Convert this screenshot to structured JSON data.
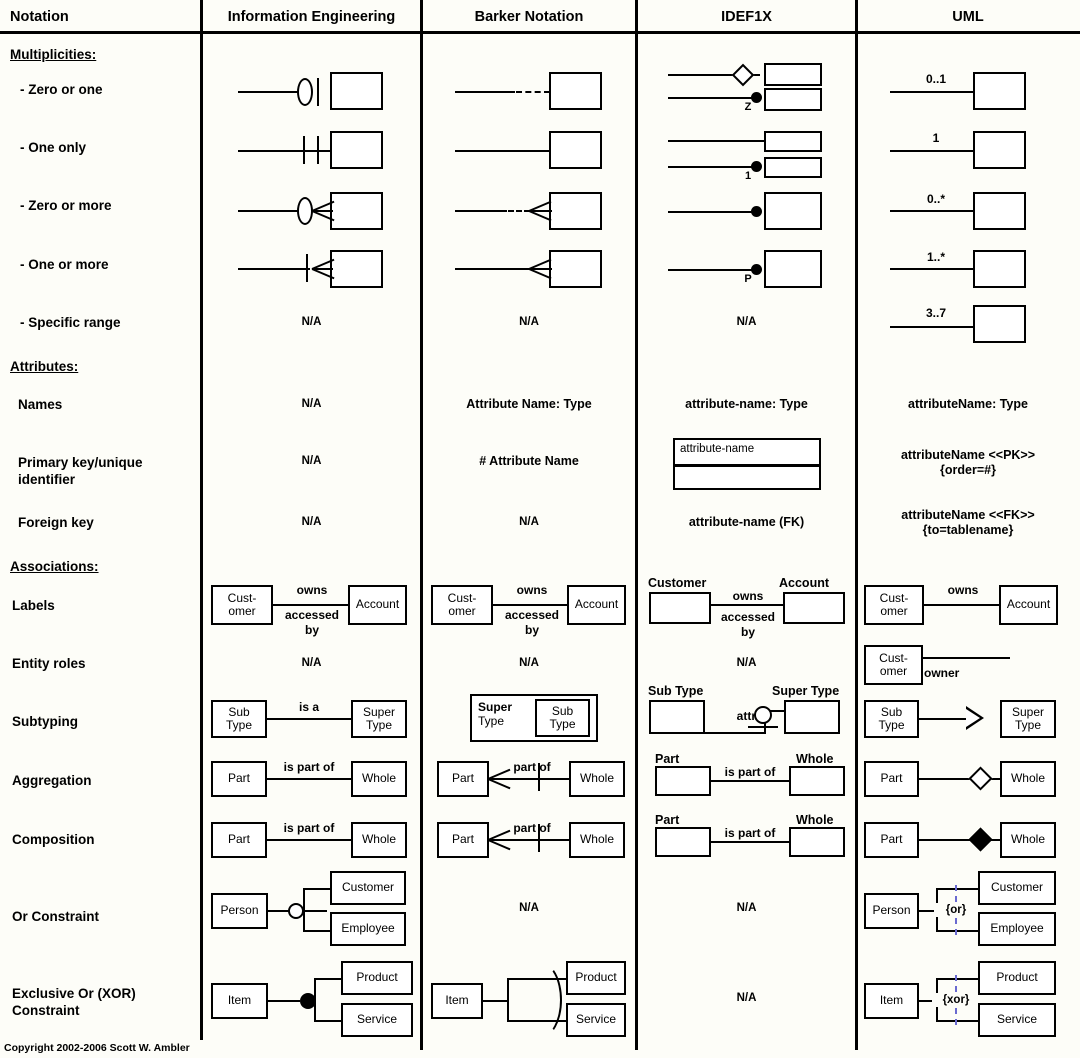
{
  "columns": [
    {
      "id": "notation",
      "label": "Notation"
    },
    {
      "id": "ie",
      "label": "Information Engineering"
    },
    {
      "id": "barker",
      "label": "Barker Notation"
    },
    {
      "id": "idef1x",
      "label": "IDEF1X"
    },
    {
      "id": "uml",
      "label": "UML"
    }
  ],
  "sections": {
    "multiplicities": "Multiplicities:",
    "attributes": "Attributes:",
    "associations": "Associations:"
  },
  "rows": {
    "zero_or_one": "- Zero or one",
    "one_only": "- One only",
    "zero_or_more": "- Zero or more",
    "one_or_more": "- One or more",
    "specific_range": "- Specific range",
    "names": "Names",
    "primary_key": "Primary key/unique identifier",
    "primary_key_l1": "Primary key/unique",
    "primary_key_l2": "identifier",
    "foreign_key": "Foreign key",
    "labels": "Labels",
    "entity_roles": "Entity roles",
    "subtyping": "Subtyping",
    "aggregation": "Aggregation",
    "composition": "Composition",
    "or_constraint": "Or Constraint",
    "xor_constraint": "Exclusive Or (XOR) Constraint",
    "xor_constraint_l1": "Exclusive Or (XOR)",
    "xor_constraint_l2": "Constraint"
  },
  "na": "N/A",
  "multiplicity_annotations": {
    "idef1x_zero_or_one": "Z",
    "idef1x_one_only": "1",
    "idef1x_one_or_more": "P",
    "uml_zero_or_one": "0..1",
    "uml_one_only": "1",
    "uml_zero_or_more": "0..*",
    "uml_one_or_more": "1..*",
    "uml_specific_range": "3..7"
  },
  "attributes": {
    "names": {
      "ie": "N/A",
      "barker": "Attribute Name: Type",
      "idef1x": "attribute-name: Type",
      "uml": "attributeName: Type"
    },
    "primary_key": {
      "ie": "N/A",
      "barker": "# Attribute Name",
      "idef1x_box_text": "attribute-name",
      "uml_l1": "attributeName <<PK>>",
      "uml_l2": "{order=#}"
    },
    "foreign_key": {
      "ie": "N/A",
      "barker": "N/A",
      "idef1x": "attribute-name (FK)",
      "uml_l1": "attributeName <<FK>>",
      "uml_l2": "{to=tablename}"
    }
  },
  "associations": {
    "labels": {
      "entity_left_l1": "Cust-",
      "entity_left_l2": "omer",
      "entity_left_full": "Customer",
      "entity_right": "Account",
      "verb_forward": "owns",
      "verb_reverse_l1": "accessed",
      "verb_reverse_l2": "by",
      "ie": "present",
      "barker": "present",
      "idef1x": "present",
      "uml": "present"
    },
    "entity_roles": {
      "ie": "N/A",
      "barker": "N/A",
      "idef1x": "N/A",
      "uml_entity_l1": "Cust-",
      "uml_entity_l2": "omer",
      "uml_role": "owner"
    },
    "subtyping": {
      "sub_l1": "Sub",
      "sub_l2": "Type",
      "super_l1": "Super",
      "super_l2": "Type",
      "sub_full": "Sub Type",
      "super_full": "Super Type",
      "ie_label": "is a",
      "idef1x_discriminator": "attr"
    },
    "aggregation": {
      "part": "Part",
      "whole": "Whole",
      "ie_label": "is part of",
      "barker_label": "part of",
      "idef1x_label": "is part of"
    },
    "composition": {
      "part": "Part",
      "whole": "Whole",
      "ie_label": "is part of",
      "barker_label": "part of",
      "idef1x_label": "is part of"
    },
    "or_constraint": {
      "source": "Person",
      "target_a": "Customer",
      "target_b": "Employee",
      "barker": "N/A",
      "idef1x": "N/A",
      "uml_constraint": "{or}"
    },
    "xor_constraint": {
      "source": "Item",
      "target_a": "Product",
      "target_b": "Service",
      "idef1x": "N/A",
      "uml_constraint": "{xor}"
    }
  },
  "footer": "Copyright 2002-2006 Scott W. Ambler",
  "colors": {
    "ink": "#000000",
    "page": "#fdfdf8",
    "constraint_dash": "#6a6ad0"
  }
}
